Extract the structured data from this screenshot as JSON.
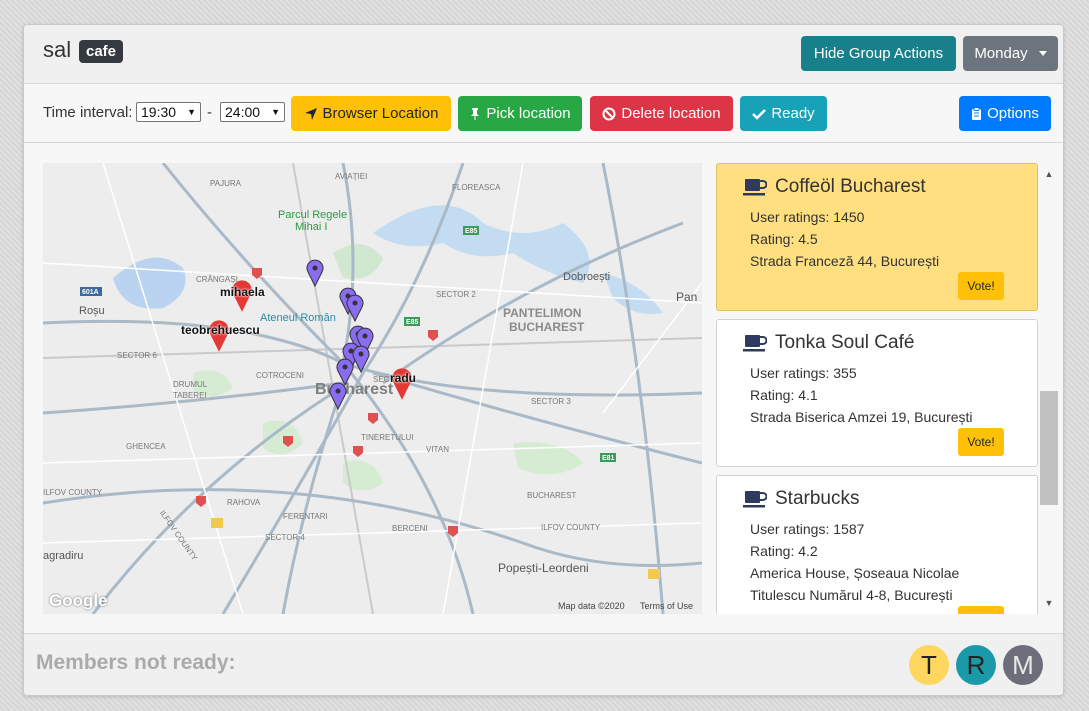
{
  "header": {
    "group_name": "sal",
    "group_badge": "cafe",
    "hide_group_actions_label": "Hide Group Actions",
    "day_label": "Monday"
  },
  "toolbar": {
    "time_interval_label": "Time interval:",
    "start_time": "19:30",
    "separator": "-",
    "end_time": "24:00",
    "browser_location_label": "Browser Location",
    "pick_location_label": "Pick location",
    "delete_location_label": "Delete location",
    "ready_label": "Ready",
    "options_label": "Options"
  },
  "map": {
    "members": [
      {
        "name": "mihaela"
      },
      {
        "name": "teobrehuescu"
      },
      {
        "name": "radu"
      }
    ],
    "labels": {
      "bucharest": "Bucharest",
      "pajura": "PAJURA",
      "parcul": "Parcul Regele",
      "mihai": "Mihai I",
      "ateneul": "Ateneul Român",
      "rosu": "Roșu",
      "cotroceni": "COTROCENI",
      "drumul": "DRUMUL TABEREI",
      "ghencea": "GHENCEA",
      "rahova": "RAHOVA",
      "ferentari": "FERENTARI",
      "berceni": "BERCENI",
      "vitan": "VITAN",
      "sector3": "SECTOR 3",
      "sector2": "SECTOR 2",
      "sector4": "SECTOR 4",
      "sector5": "SECTOR 5",
      "sector6": "SECTOR 6",
      "pantelimon": "PANTELIMON",
      "pantelimon_sub": "BUCHAREST",
      "dobroesti": "Dobroești",
      "popesti": "Popești-Leordeni",
      "ilfov": "ILFOV COUNTY",
      "ilfov2": "ILFOV COUNTY",
      "ilfov3": "ILFOV COUNTY",
      "tineretului": "TINERETULUI",
      "aviatiei": "AVIAȚIEI",
      "floreasca": "FLOREASCA",
      "crangasi": "CRÂNGAȘI",
      "agradiru": "agradiru",
      "bucharest_small": "BUCHAREST",
      "pan": "Pan",
      "a601": "601A"
    },
    "google_logo": "Google",
    "map_data": "Map data ©2020",
    "terms": "Terms of Use"
  },
  "places": [
    {
      "name": "Coffeöl Bucharest",
      "user_ratings": "User ratings: 1450",
      "rating": "Rating: 4.5",
      "address1": "Strada Franceză 44, București",
      "address2": "",
      "vote_label": "Vote!",
      "highlighted": true
    },
    {
      "name": "Tonka Soul Café",
      "user_ratings": "User ratings: 355",
      "rating": "Rating: 4.1",
      "address1": "Strada Biserica Amzei 19, București",
      "address2": "",
      "vote_label": "Vote!",
      "highlighted": false
    },
    {
      "name": "Starbucks",
      "user_ratings": "User ratings: 1587",
      "rating": "Rating: 4.2",
      "address1": "America House, Șoseaua Nicolae",
      "address2": "Titulescu Numărul 4-8, București",
      "vote_label": "Vote!",
      "highlighted": false
    }
  ],
  "footer": {
    "title": "Members not ready:",
    "members": [
      {
        "initial": "T",
        "color": "#ffd75e"
      },
      {
        "initial": "R",
        "color": "#1a9aa8"
      },
      {
        "initial": "M",
        "color": "#6c6f7a"
      }
    ]
  },
  "colors": {
    "member_pin": "#e53935",
    "place_pin": "#8a6cf0",
    "highlight": "#ffdf80"
  }
}
